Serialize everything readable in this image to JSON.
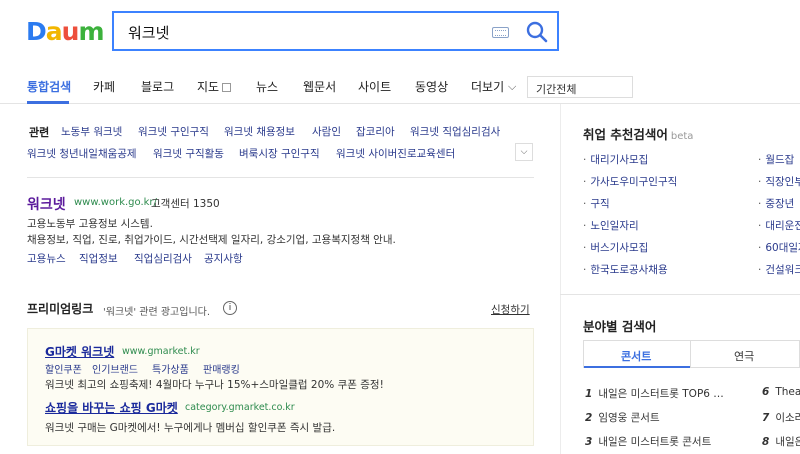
{
  "logo": {
    "text": "Daum",
    "colors": [
      "#2b7bf0",
      "#f2b600",
      "#ed4f3c",
      "#3cb13c"
    ]
  },
  "search": {
    "query": "워크넷"
  },
  "tabs": [
    {
      "label": "통합검색"
    },
    {
      "label": "카페"
    },
    {
      "label": "블로그"
    },
    {
      "label": "지도"
    },
    {
      "label": "뉴스"
    },
    {
      "label": "웹문서"
    },
    {
      "label": "사이트"
    },
    {
      "label": "동영상"
    },
    {
      "label": "더보기"
    }
  ],
  "period_select": "기간전체",
  "related": {
    "title": "관련",
    "items": [
      "노동부 워크넷",
      "워크넷 구인구직",
      "워크넷 채용정보",
      "사람인",
      "잡코리아",
      "워크넷 직업심리검사",
      "워크넷 청년내일채움공제",
      "워크넷 구직활동",
      "벼룩시장 구인구직",
      "워크넷 사이버진로교육센터"
    ]
  },
  "site": {
    "title": "워크넷",
    "url": "www.work.go.kr/",
    "center": "고객센터 1350",
    "desc": [
      "고용노동부 고용정보 시스템.",
      "채용정보, 직업, 진로, 취업가이드, 시간선택제 일자리, 강소기업, 고용복지정책 안내."
    ],
    "links": [
      "고용뉴스",
      "직업정보",
      "직업심리검사",
      "공지사항"
    ]
  },
  "premium": {
    "title": "프리미엄링크",
    "note": "'워크넷' 관련 광고입니다.",
    "info": "i",
    "apply": "신청하기",
    "ads": [
      {
        "title": "G마켓 워크넷",
        "url": "www.gmarket.kr",
        "subs": [
          "할인쿠폰",
          "인기브랜드",
          "특가상품",
          "판매랭킹"
        ],
        "desc": "워크넷 최고의 쇼핑축제! 4월마다 누구나 15%+스마일클럽 20% 쿠폰 증정!"
      },
      {
        "title": "쇼핑을 바꾸는 쇼핑 G마켓",
        "url": "category.gmarket.co.kr",
        "subs": [],
        "desc": "워크넷 구매는 G마켓에서! 누구에게나 멤버십 할인쿠폰 즉시 발급."
      }
    ]
  },
  "sidebar": {
    "job_title": "취업 추천검색어",
    "beta": "beta",
    "job_items": [
      "대리기사모집",
      "가사도우미구인구직",
      "구직",
      "노인일자리",
      "버스기사모집",
      "한국도로공사채용",
      "월드잡",
      "직장인부",
      "중장년",
      "대리운전",
      "60대일자",
      "건설워크"
    ],
    "category_title": "분야별 검색어",
    "cat_tabs": [
      "콘서트",
      "연극"
    ],
    "ranks": [
      {
        "num": "1",
        "text": "내일은 미스터트롯 TOP6 …"
      },
      {
        "num": "2",
        "text": "임영웅 콘서트"
      },
      {
        "num": "3",
        "text": "내일은 미스터트롯 콘서트"
      },
      {
        "num": "6",
        "text": "Theat"
      },
      {
        "num": "7",
        "text": "이소라"
      },
      {
        "num": "8",
        "text": "내일은"
      }
    ]
  }
}
